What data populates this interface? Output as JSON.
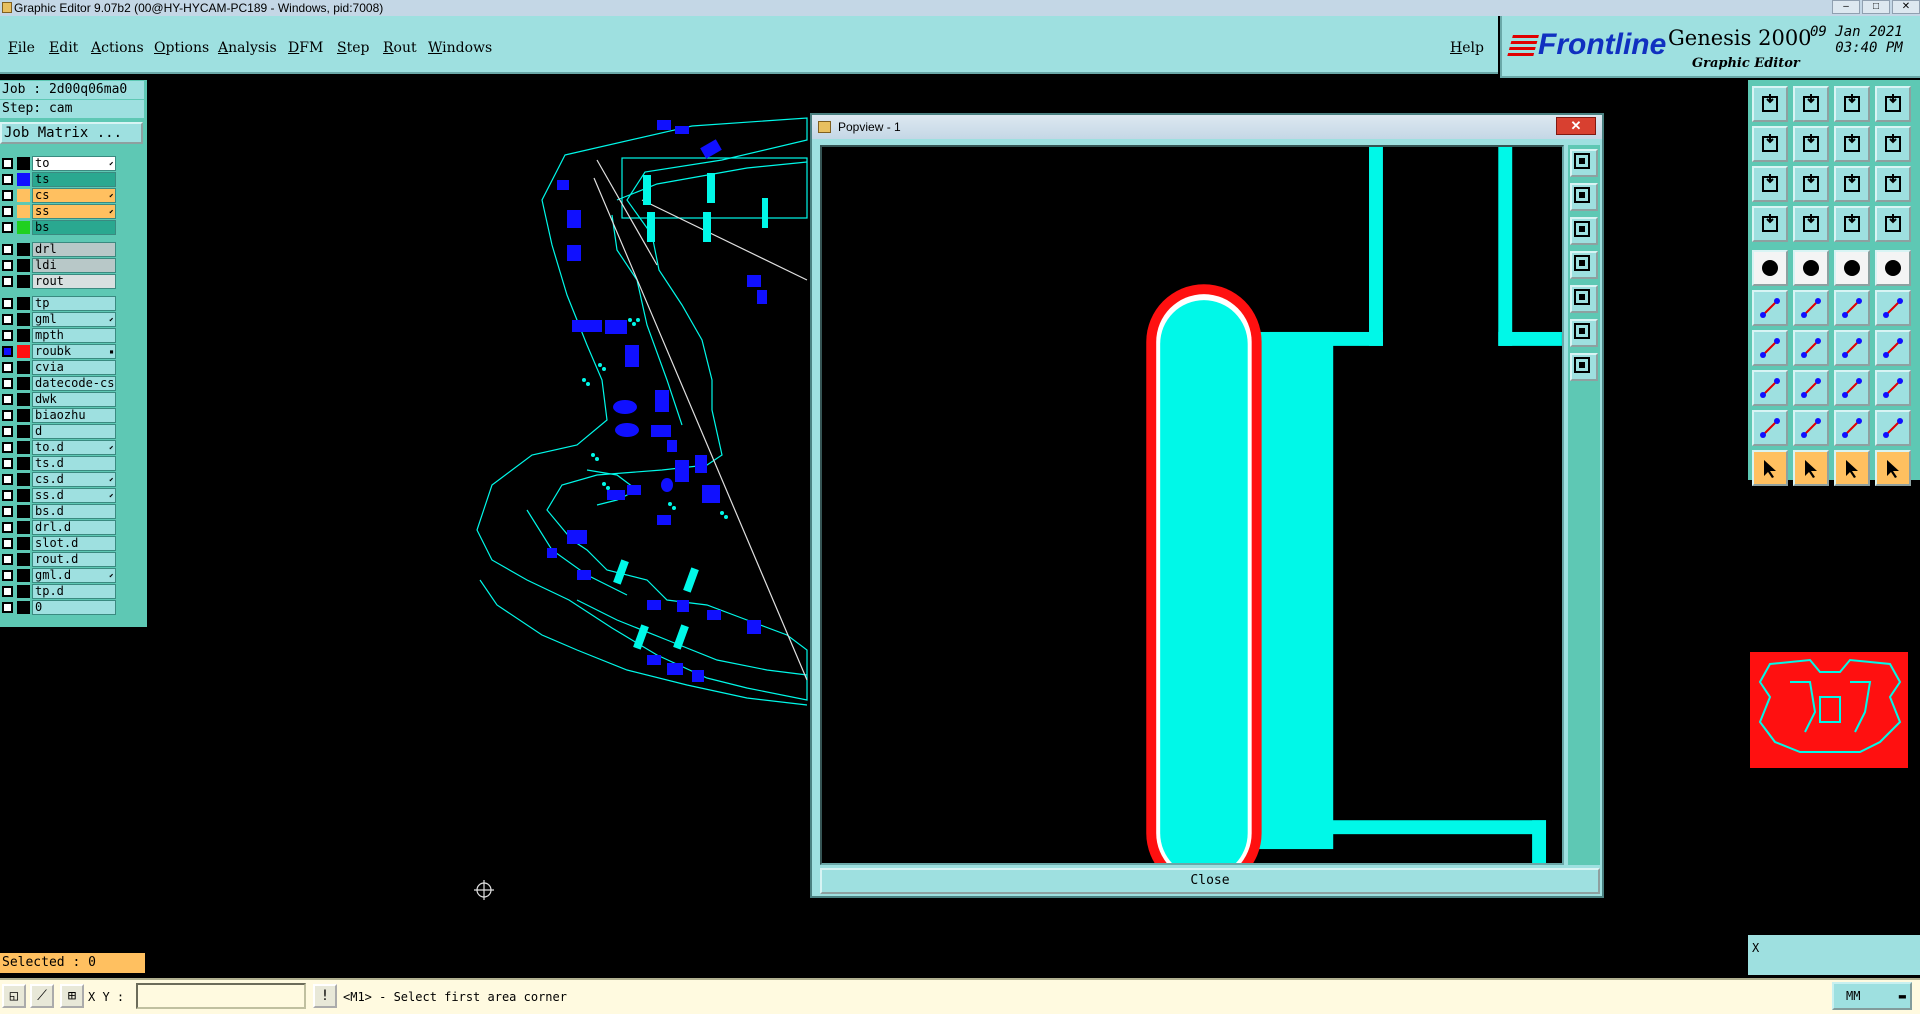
{
  "window": {
    "title": "Graphic Editor 9.07b2 (00@HY-HYCAM-PC189 - Windows, pid:7008)",
    "btn_min": "–",
    "btn_max": "□",
    "btn_close": "✕"
  },
  "menu": {
    "items": [
      "File",
      "Edit",
      "Actions",
      "Options",
      "Analysis",
      "DFM",
      "Step",
      "Rout",
      "Windows"
    ],
    "help": "Help"
  },
  "brand": {
    "logo": "Frontline",
    "product": "Genesis 2000",
    "subtitle": "Graphic Editor",
    "date": "09 Jan 2021",
    "time": "03:40 PM"
  },
  "job": {
    "job_label": "Job : 2d00q06ma0",
    "step_label": "Step: cam",
    "matrix_button": "Job Matrix ..."
  },
  "layers": [
    {
      "name": "to",
      "color": "#000000",
      "style": "board",
      "flag": "⬋"
    },
    {
      "name": "ts",
      "color": "#1010ff",
      "style": "teal",
      "flag": ""
    },
    {
      "name": "cs",
      "color": "#ffc060",
      "style": "orange",
      "flag": "⬋"
    },
    {
      "name": "ss",
      "color": "#ffc060",
      "style": "orange",
      "flag": "⬋"
    },
    {
      "name": "bs",
      "color": "#20d020",
      "style": "teal",
      "flag": ""
    },
    {
      "name": "drl",
      "color": "#000000",
      "style": "grey",
      "flag": ""
    },
    {
      "name": "ldi",
      "color": "#000000",
      "style": "grey",
      "flag": ""
    },
    {
      "name": "rout",
      "color": "#000000",
      "style": "lgrey",
      "flag": ""
    },
    {
      "name": "tp",
      "color": "#000000",
      "style": "teal",
      "flag": ""
    },
    {
      "name": "gml",
      "color": "#000000",
      "style": "teal",
      "flag": "⬋"
    },
    {
      "name": "mpth",
      "color": "#000000",
      "style": "teal",
      "flag": ""
    },
    {
      "name": "roubk",
      "color": "#ff1010",
      "style": "teal",
      "flag": "▪",
      "checked": true
    },
    {
      "name": "cvia",
      "color": "#000000",
      "style": "teal",
      "flag": ""
    },
    {
      "name": "datecode-cs",
      "color": "#000000",
      "style": "teal",
      "flag": ""
    },
    {
      "name": "dwk",
      "color": "#000000",
      "style": "teal",
      "flag": ""
    },
    {
      "name": "biaozhu",
      "color": "#000000",
      "style": "teal",
      "flag": ""
    },
    {
      "name": "d",
      "color": "#000000",
      "style": "teal",
      "flag": ""
    },
    {
      "name": "to.d",
      "color": "#000000",
      "style": "teal",
      "flag": "⬋"
    },
    {
      "name": "ts.d",
      "color": "#000000",
      "style": "teal",
      "flag": ""
    },
    {
      "name": "cs.d",
      "color": "#000000",
      "style": "teal",
      "flag": "⬋"
    },
    {
      "name": "ss.d",
      "color": "#000000",
      "style": "teal",
      "flag": "⬋"
    },
    {
      "name": "bs.d",
      "color": "#000000",
      "style": "teal",
      "flag": ""
    },
    {
      "name": "drl.d",
      "color": "#000000",
      "style": "teal",
      "flag": ""
    },
    {
      "name": "slot.d",
      "color": "#000000",
      "style": "teal",
      "flag": ""
    },
    {
      "name": "rout.d",
      "color": "#000000",
      "style": "teal",
      "flag": ""
    },
    {
      "name": "gml.d",
      "color": "#000000",
      "style": "teal",
      "flag": "⬋"
    },
    {
      "name": "tp.d",
      "color": "#000000",
      "style": "teal",
      "flag": ""
    },
    {
      "name": "0",
      "color": "#000000",
      "style": "teal",
      "flag": ""
    }
  ],
  "selected": "Selected : 0",
  "status": {
    "xy_label": "X Y :",
    "xy_value": "",
    "message": "<M1> - Select first area corner",
    "units": "MM"
  },
  "popup": {
    "title": "Popview - 1",
    "close_label": "Close"
  },
  "right_panel": {
    "x_label": "X"
  },
  "colors": {
    "teal_panel": "#9ee0e0",
    "mint": "#5ec8b4",
    "cyan_feature": "#00f8e8",
    "blue_pad": "#1010ff",
    "red_outline": "#ff1010",
    "orange": "#ffc060"
  }
}
